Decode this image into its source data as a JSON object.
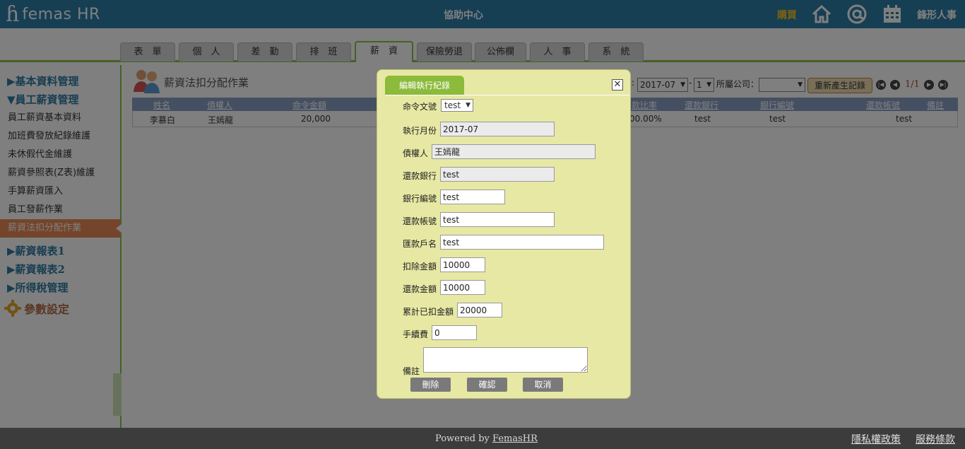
{
  "header": {
    "logo_mark": "ɦ",
    "logo_text": "femas HR",
    "help_center": "協助中心",
    "buy": "購買",
    "brand": "鋒形人事",
    "colors": {
      "bar": "#2d7fa8",
      "buy": "#f5c324"
    }
  },
  "tabs": [
    {
      "label": "表　單"
    },
    {
      "label": "個　人"
    },
    {
      "label": "差　勤"
    },
    {
      "label": "排　班"
    },
    {
      "label": "薪　資",
      "active": true
    },
    {
      "label": "保險勞退"
    },
    {
      "label": "公佈欄"
    },
    {
      "label": "人　事"
    },
    {
      "label": "系　統"
    }
  ],
  "sidebar": {
    "groups": [
      {
        "label": "▶基本資料管理"
      },
      {
        "label": "▼員工薪資管理"
      },
      {
        "label": "▶薪資報表1"
      },
      {
        "label": "▶薪資報表2"
      },
      {
        "label": "▶所得稅管理"
      }
    ],
    "items": [
      {
        "label": "員工薪資基本資料"
      },
      {
        "label": "加班費發放紀錄維護"
      },
      {
        "label": "未休假代金維護"
      },
      {
        "label": "薪資參照表(Z表)維護"
      },
      {
        "label": "手算薪資匯入"
      },
      {
        "label": "員工發薪作業"
      },
      {
        "label": "薪資法扣分配作業",
        "active": true
      }
    ],
    "param": "參數設定"
  },
  "main": {
    "title": "薪資法扣分配作業",
    "toolbar": {
      "colon": ":",
      "month": "2017-07",
      "dash": "-",
      "seq": "1",
      "company_label": "所屬公司：",
      "company_value": "",
      "regen_button": "重新產生記錄",
      "page": "1/1"
    },
    "columns": [
      "姓名",
      "債權人",
      "命令金額",
      "款比率",
      "還款銀行",
      "銀行編號",
      "還款帳號",
      "備註"
    ],
    "rows": [
      {
        "name": "李慕白",
        "creditor": "王嫣龍",
        "amount": "20,000",
        "ratio": "00.00%",
        "bank": "test",
        "bank_no": "test",
        "account": "test",
        "note": ""
      }
    ]
  },
  "dialog": {
    "title": "編輯執行紀錄",
    "close": "✕",
    "fields": {
      "order_no": {
        "label": "命令文號",
        "value": "test"
      },
      "exec_month": {
        "label": "執行月份",
        "value": "2017-07"
      },
      "creditor": {
        "label": "債權人",
        "value": "王嫣龍"
      },
      "repay_bank": {
        "label": "還款銀行",
        "value": "test"
      },
      "bank_no": {
        "label": "銀行編號",
        "value": "test"
      },
      "repay_account": {
        "label": "還款帳號",
        "value": "test"
      },
      "remit_name": {
        "label": "匯款戶名",
        "value": "test"
      },
      "deduct_amount": {
        "label": "扣除金額",
        "value": "10000"
      },
      "repay_amount": {
        "label": "還款金額",
        "value": "10000"
      },
      "accum_deducted": {
        "label": "累計已扣金額",
        "value": "20000"
      },
      "fee": {
        "label": "手續費",
        "value": "0"
      },
      "note": {
        "label": "備註",
        "value": ""
      }
    },
    "buttons": {
      "delete": "刪除",
      "confirm": "確認",
      "cancel": "取消"
    }
  },
  "footer": {
    "powered_prefix": "Powered by ",
    "powered_link": "FemasHR",
    "privacy": "隱私權政策",
    "terms": "服務條款"
  }
}
